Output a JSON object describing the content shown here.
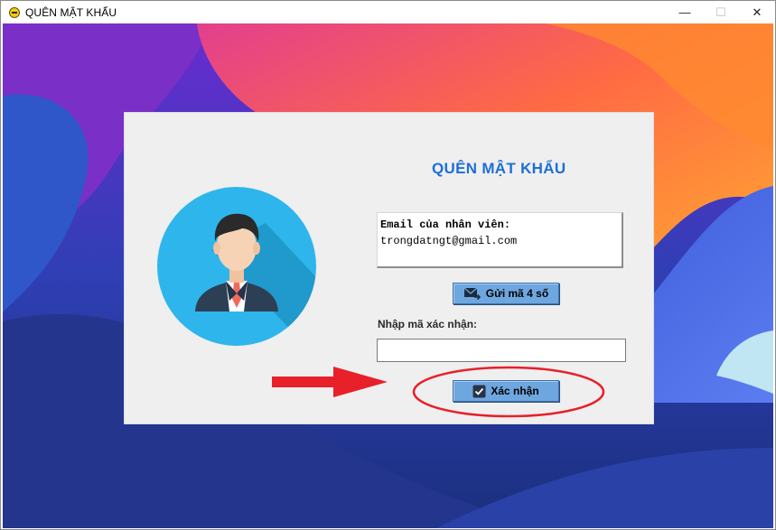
{
  "window": {
    "title": "QUÊN MẬT KHẨU",
    "controls": {
      "minimize": "—",
      "maximize": "☐",
      "close": "✕"
    }
  },
  "form": {
    "heading": "QUÊN MẬT KHẨU",
    "email_label": "Email của nhân viên:",
    "email_value": "trongdatngt@gmail.com",
    "send_button_label": "Gửi mã 4 số",
    "code_label": "Nhập mã xác nhận:",
    "code_value": "",
    "confirm_button_label": "Xác nhận"
  },
  "colors": {
    "heading": "#1d6fd6",
    "button": "#6ea7e0",
    "annotation": "#e8202a",
    "avatar_circle": "#2eb6ec"
  },
  "icons": {
    "app": "app-icon",
    "send": "envelope-arrow-icon",
    "confirm": "checkbox-check-icon"
  }
}
